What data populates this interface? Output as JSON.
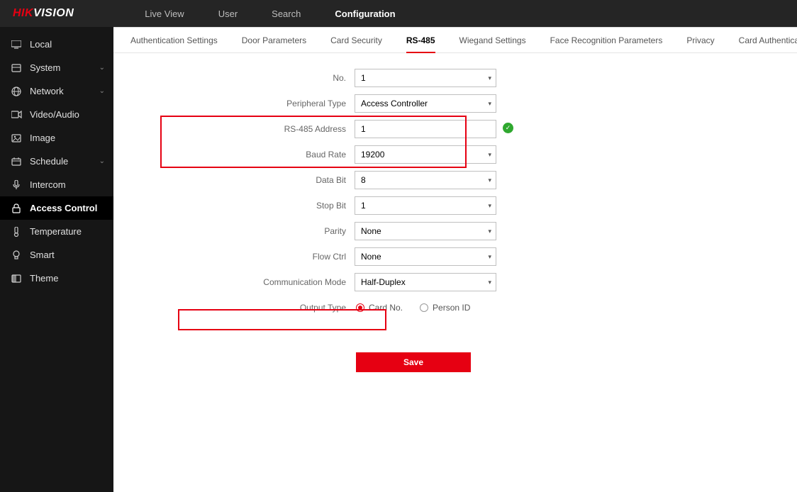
{
  "brand": {
    "hik": "HIK",
    "vision": "VISION"
  },
  "topnav": {
    "live_view": "Live View",
    "user": "User",
    "search": "Search",
    "configuration": "Configuration"
  },
  "sidebar": {
    "local": "Local",
    "system": "System",
    "network": "Network",
    "video_audio": "Video/Audio",
    "image": "Image",
    "schedule": "Schedule",
    "intercom": "Intercom",
    "access_control": "Access Control",
    "temperature": "Temperature",
    "smart": "Smart",
    "theme": "Theme"
  },
  "subtabs": {
    "auth_settings": "Authentication Settings",
    "door_params": "Door Parameters",
    "card_security": "Card Security",
    "rs485": "RS-485",
    "wiegand": "Wiegand Settings",
    "face_rec": "Face Recognition Parameters",
    "privacy": "Privacy",
    "card_auth": "Card Authentication Settings"
  },
  "form": {
    "labels": {
      "no": "No.",
      "peripheral_type": "Peripheral Type",
      "rs485_address": "RS-485 Address",
      "baud_rate": "Baud Rate",
      "data_bit": "Data Bit",
      "stop_bit": "Stop Bit",
      "parity": "Parity",
      "flow_ctrl": "Flow Ctrl",
      "comm_mode": "Communication Mode",
      "output_type": "Output Type"
    },
    "values": {
      "no": "1",
      "peripheral_type": "Access Controller",
      "rs485_address": "1",
      "baud_rate": "19200",
      "data_bit": "8",
      "stop_bit": "1",
      "parity": "None",
      "flow_ctrl": "None",
      "comm_mode": "Half-Duplex"
    },
    "output_type": {
      "card_no": "Card No.",
      "person_id": "Person ID",
      "selected": "card_no"
    },
    "save": "Save"
  }
}
